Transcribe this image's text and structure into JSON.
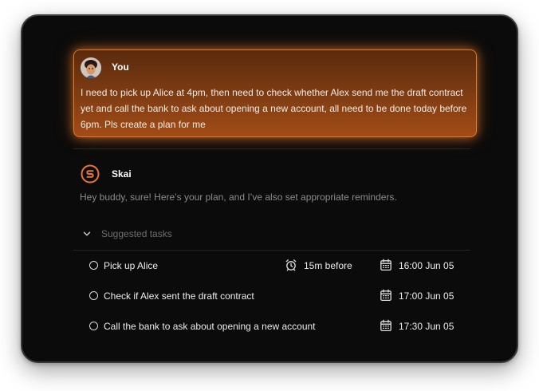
{
  "chat": {
    "user": {
      "name": "You",
      "message": "I need to pick up Alice at 4pm, then need to check whether Alex send me the draft contract yet and call the bank to ask about opening a new account, all need to be done today before 6pm. Pls create a plan for me"
    },
    "assistant": {
      "name": "Skai",
      "message": "Hey buddy, sure! Here’s your plan, and I’ve also set appropriate reminders."
    }
  },
  "suggested": {
    "label": "Suggested tasks",
    "tasks": [
      {
        "label": "Pick up Alice",
        "reminder": "15m before",
        "due": "16:00 Jun 05"
      },
      {
        "label": "Check if Alex sent the draft contract",
        "reminder": "",
        "due": "17:00 Jun 05"
      },
      {
        "label": "Call the bank to ask about opening a new account",
        "reminder": "",
        "due": "17:30 Jun 05"
      }
    ]
  },
  "colors": {
    "accent": "#e8762c",
    "background": "#0b0b0b",
    "muted_text": "#8a8a8a"
  },
  "icons": {
    "avatar": "user-avatar",
    "assistant_logo": "skai-logo-icon",
    "chevron": "chevron-down-icon",
    "task_check": "circle-checkbox-icon",
    "reminder": "alarm-clock-icon",
    "due": "calendar-icon"
  }
}
